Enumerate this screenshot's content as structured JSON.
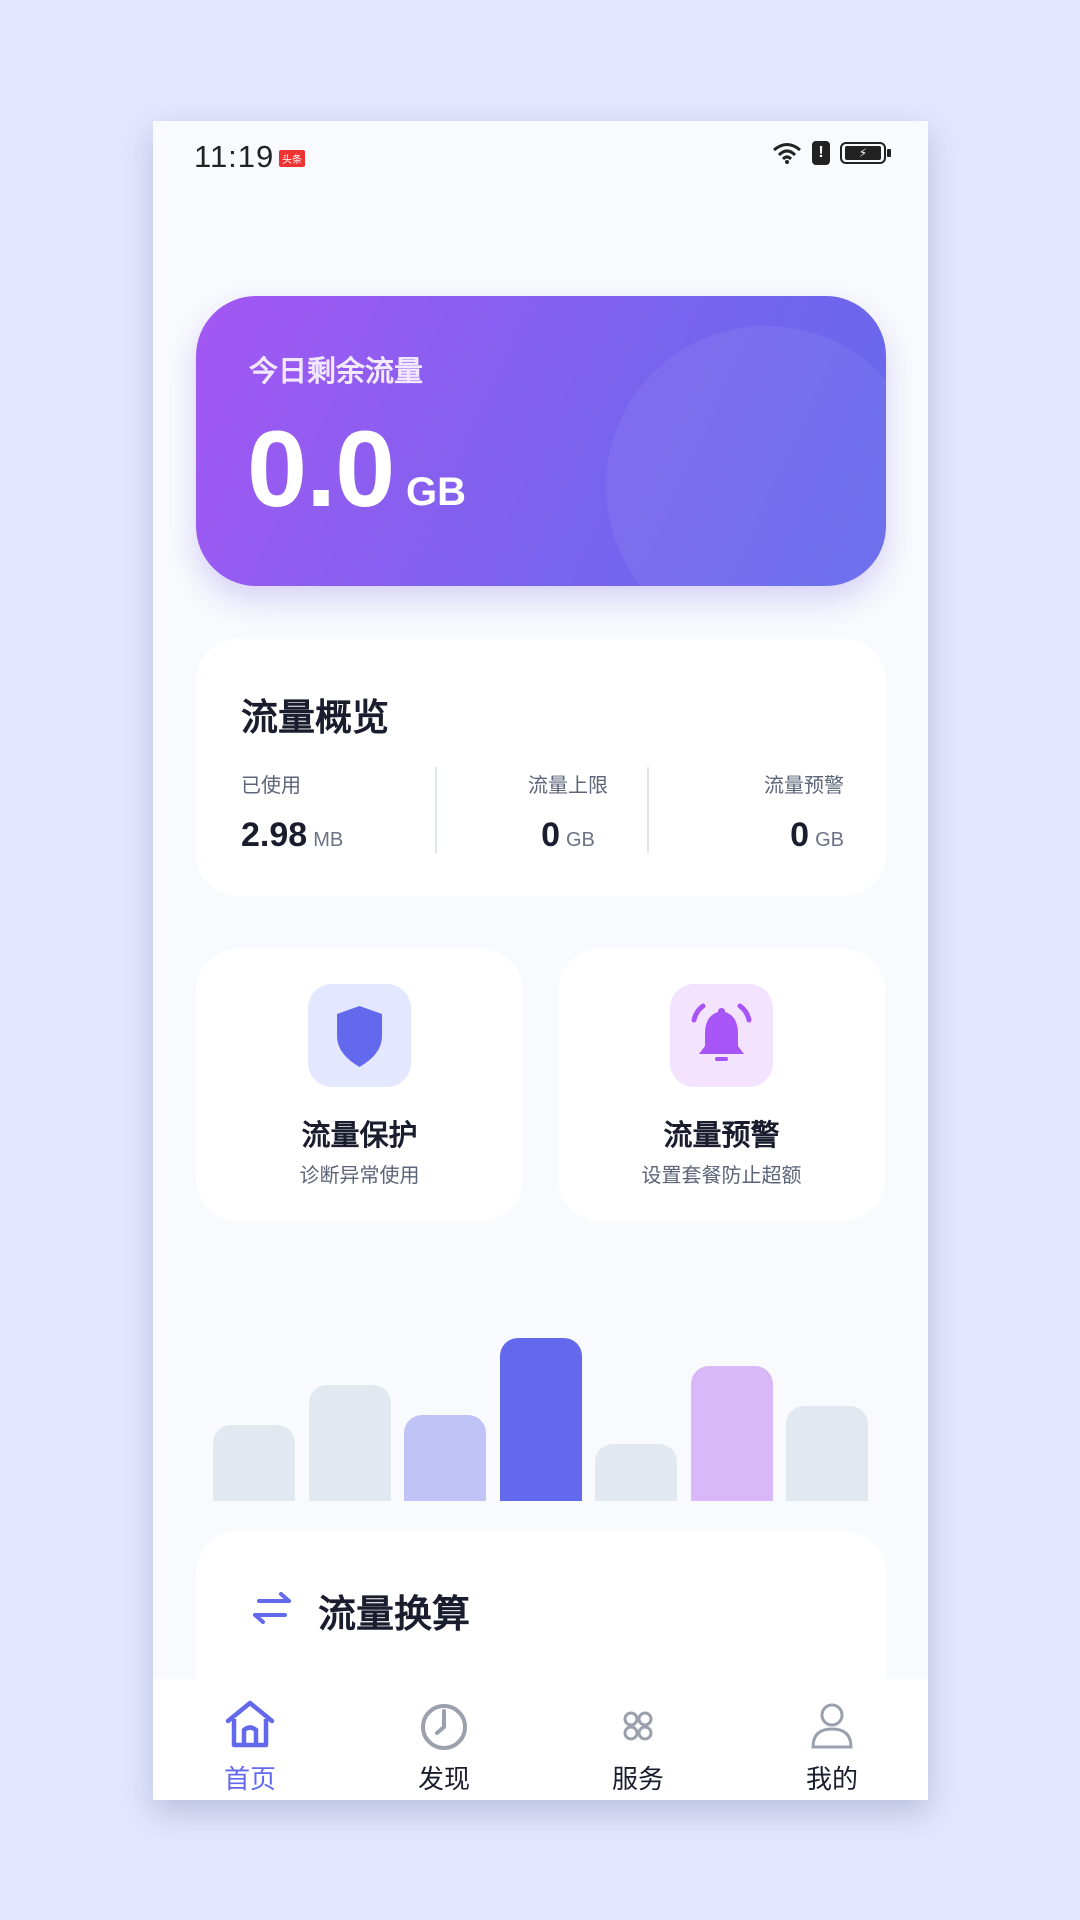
{
  "status_bar": {
    "time": "11:19",
    "badge": "头条",
    "warning_symbol": "!",
    "bolt_symbol": "⚡"
  },
  "hero": {
    "label": "今日剩余流量",
    "value": "0.0",
    "unit": "GB"
  },
  "overview": {
    "title": "流量概览",
    "stats": [
      {
        "label": "已使用",
        "value": "2.98",
        "unit": "MB"
      },
      {
        "label": "流量上限",
        "value": "0",
        "unit": "GB"
      },
      {
        "label": "流量预警",
        "value": "0",
        "unit": "GB"
      }
    ]
  },
  "feature_cards": [
    {
      "title": "流量保护",
      "subtitle": "诊断异常使用",
      "icon": "shield-icon",
      "bg": "#e3e7ff",
      "color": "#6369ec"
    },
    {
      "title": "流量预警",
      "subtitle": "设置套餐防止超额",
      "icon": "bell-icon",
      "bg": "#f3e3ff",
      "color": "#a855f7"
    }
  ],
  "usage_bars": [
    {
      "level": 0.4,
      "color": "#e2e8f0"
    },
    {
      "level": 0.61,
      "color": "#e2e8f0"
    },
    {
      "level": 0.45,
      "color": "#bfc3f5"
    },
    {
      "level": 0.86,
      "color": "#6369ec"
    },
    {
      "level": 0.3,
      "color": "#e2e8f0"
    },
    {
      "level": 0.71,
      "color": "#d8b8f8"
    },
    {
      "level": 0.5,
      "color": "#e2e8f0"
    }
  ],
  "converter": {
    "title": "流量换算",
    "icon": "swap-arrows-icon"
  },
  "bottom_nav": [
    {
      "label": "首页",
      "icon": "home-icon",
      "active": true
    },
    {
      "label": "发现",
      "icon": "compass-icon",
      "active": false
    },
    {
      "label": "服务",
      "icon": "services-icon",
      "active": false
    },
    {
      "label": "我的",
      "icon": "user-icon",
      "active": false
    }
  ],
  "colors": {
    "accent": "#6369ec",
    "hero_gradient_start": "#a457f3",
    "hero_gradient_end": "#6369ec"
  }
}
